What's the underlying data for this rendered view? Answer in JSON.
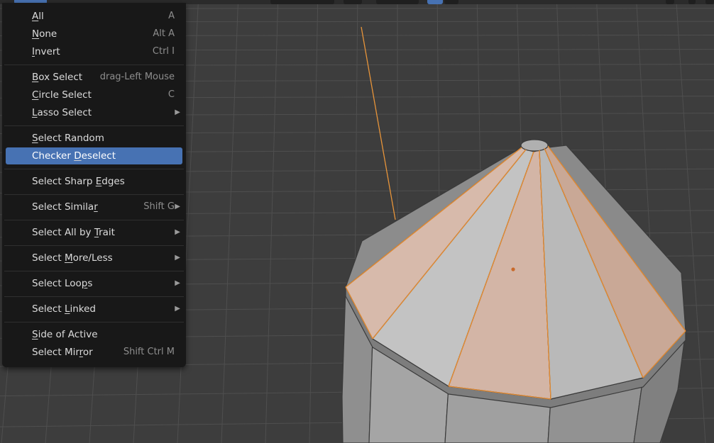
{
  "menu": {
    "items": [
      {
        "id": "all",
        "label": "All",
        "underline": 0,
        "shortcut": "A",
        "submenu": false,
        "active": false
      },
      {
        "id": "none",
        "label": "None",
        "underline": 0,
        "shortcut": "Alt A",
        "submenu": false,
        "active": false
      },
      {
        "id": "invert",
        "label": "Invert",
        "underline": 0,
        "shortcut": "Ctrl I",
        "submenu": false,
        "active": false
      },
      {
        "id": "box-select",
        "label": "Box Select",
        "underline": 0,
        "shortcut": "drag-Left Mouse",
        "submenu": false,
        "active": false
      },
      {
        "id": "circle-select",
        "label": "Circle Select",
        "underline": 0,
        "shortcut": "C",
        "submenu": false,
        "active": false
      },
      {
        "id": "lasso-select",
        "label": "Lasso Select",
        "underline": 0,
        "shortcut": "",
        "submenu": true,
        "active": false
      },
      {
        "id": "select-random",
        "label": "Select Random",
        "underline": 0,
        "shortcut": "",
        "submenu": false,
        "active": false
      },
      {
        "id": "checker-deselect",
        "label": "Checker Deselect",
        "underline": 8,
        "shortcut": "",
        "submenu": false,
        "active": true
      },
      {
        "id": "select-sharp-edges",
        "label": "Select Sharp Edges",
        "underline": 13,
        "shortcut": "",
        "submenu": false,
        "active": false
      },
      {
        "id": "select-similar",
        "label": "Select Similar",
        "underline": 13,
        "shortcut": "Shift G",
        "submenu": true,
        "active": false
      },
      {
        "id": "select-all-by-trait",
        "label": "Select All by Trait",
        "underline": 14,
        "shortcut": "",
        "submenu": true,
        "active": false
      },
      {
        "id": "select-more-less",
        "label": "Select More/Less",
        "underline": 7,
        "shortcut": "",
        "submenu": true,
        "active": false
      },
      {
        "id": "select-loops",
        "label": "Select Loops",
        "underline": 10,
        "shortcut": "",
        "submenu": true,
        "active": false
      },
      {
        "id": "select-linked",
        "label": "Select Linked",
        "underline": 7,
        "shortcut": "",
        "submenu": true,
        "active": false
      },
      {
        "id": "side-of-active",
        "label": "Side of Active",
        "underline": 0,
        "shortcut": "",
        "submenu": false,
        "active": false
      },
      {
        "id": "select-mirror",
        "label": "Select Mirror",
        "underline": 10,
        "shortcut": "Shift Ctrl M",
        "submenu": false,
        "active": false
      }
    ]
  },
  "colors": {
    "viewport_bg": "#3d3d3d",
    "grid_line": "#4d4d4d",
    "menu_bg": "#181818",
    "menu_highlight": "#4772b3",
    "selected_face": "#d2b6a8",
    "selected_edge": "#e98c2e",
    "mesh_face": "#b4b4b4",
    "axis_line": "#e7943a"
  },
  "icons": {
    "submenu": "triangle-right-icon"
  }
}
